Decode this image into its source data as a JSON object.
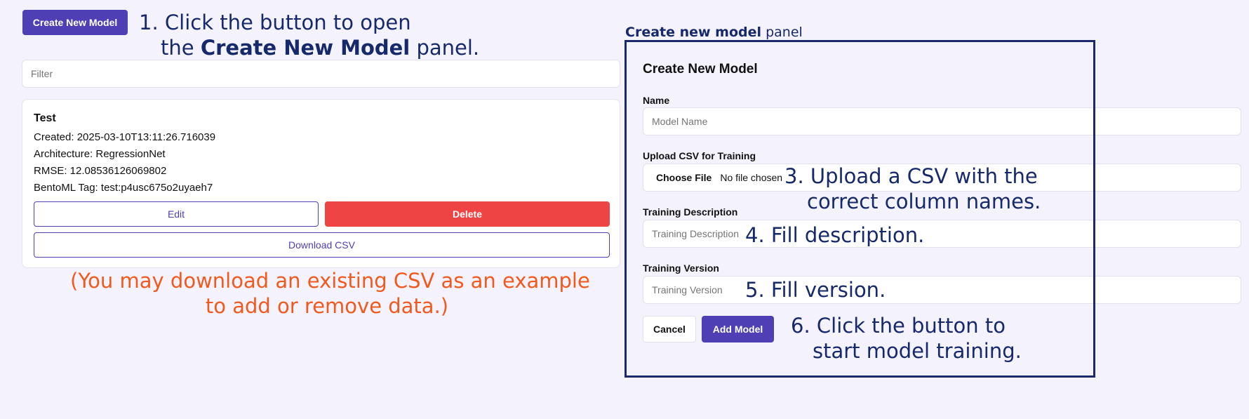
{
  "toolbar": {
    "create_button": "Create New Model"
  },
  "filter": {
    "placeholder": "Filter"
  },
  "model_card": {
    "name": "Test",
    "created": "Created: 2025-03-10T13:11:26.716039",
    "architecture": "Architecture: RegressionNet",
    "rmse": "RMSE: 12.08536126069802",
    "bento_tag": "BentoML Tag: test:p4usc675o2uyaeh7",
    "edit_label": "Edit",
    "delete_label": "Delete",
    "download_label": "Download CSV"
  },
  "annotations": {
    "step1_prefix": "1. Click the button to open",
    "step1_mid": "the ",
    "step1_bold": "Create New Model",
    "step1_suffix": " panel.",
    "panel_caption_bold": "Create new model",
    "panel_caption_rest": " panel",
    "step3_line1": "3. Upload a CSV with the",
    "step3_line2": "correct column names.",
    "step4": "4. Fill description.",
    "step5": "5. Fill version.",
    "step6_line1": "6. Click the button to",
    "step6_line2": "start model training.",
    "csv_note_line1": "(You may download an existing CSV as an example",
    "csv_note_line2": "to add or remove data.)"
  },
  "create_panel": {
    "title": "Create New Model",
    "name_label": "Name",
    "name_placeholder": "Model Name",
    "upload_label": "Upload CSV for Training",
    "choose_file_label": "Choose File",
    "no_file_text": "No file chosen",
    "description_label": "Training Description",
    "description_placeholder": "Training Description",
    "version_label": "Training Version",
    "version_placeholder": "Training Version",
    "cancel_label": "Cancel",
    "add_label": "Add Model"
  },
  "colors": {
    "accent": "#4f3fb5",
    "danger": "#ef4444",
    "annotation_blue": "#16296b",
    "annotation_orange": "#f15a1f",
    "background": "#f4f2fd"
  }
}
